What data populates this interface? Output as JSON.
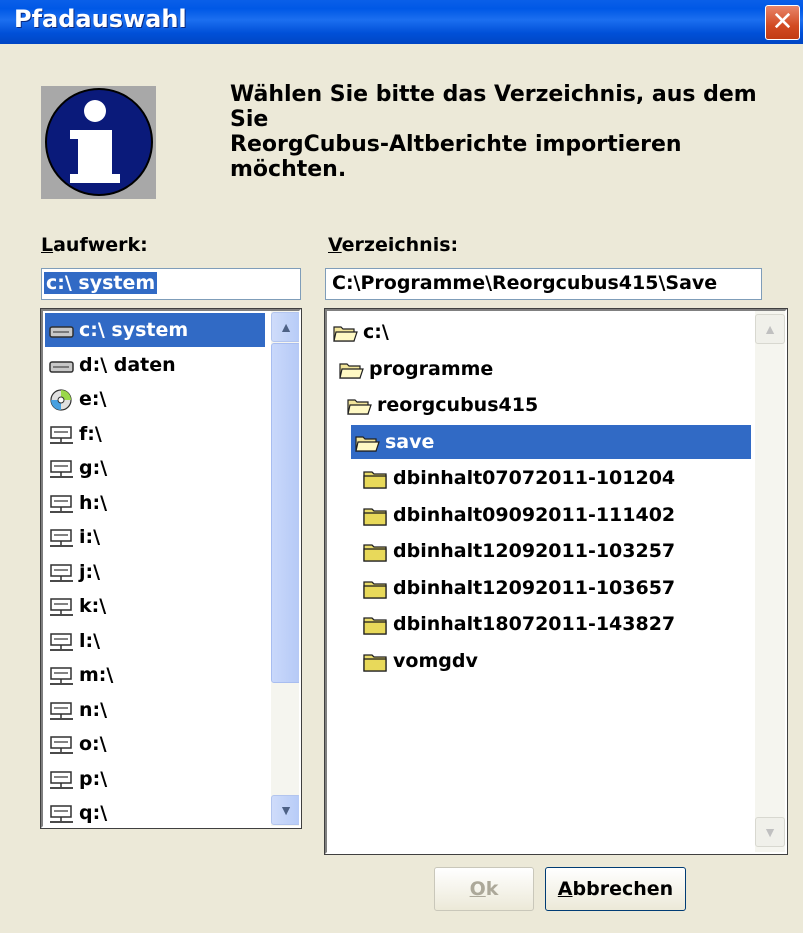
{
  "window": {
    "title": "Pfadauswahl",
    "close_glyph": "✕"
  },
  "message": {
    "line1": "Wählen Sie bitte das Verzeichnis, aus dem Sie",
    "line2": "ReorgCubus-Altberichte importieren möchten."
  },
  "drive": {
    "label_accel": "L",
    "label_rest": "aufwerk:",
    "value": "c:\\ system",
    "items": [
      {
        "label": "c:\\ system",
        "icon": "hard-drive-icon"
      },
      {
        "label": "d:\\ daten",
        "icon": "hard-drive-icon"
      },
      {
        "label": "e:\\",
        "icon": "cd-drive-icon"
      },
      {
        "label": "f:\\",
        "icon": "network-drive-icon"
      },
      {
        "label": "g:\\",
        "icon": "network-drive-icon"
      },
      {
        "label": "h:\\",
        "icon": "network-drive-icon"
      },
      {
        "label": "i:\\",
        "icon": "network-drive-icon"
      },
      {
        "label": "j:\\",
        "icon": "network-drive-icon"
      },
      {
        "label": "k:\\",
        "icon": "network-drive-icon"
      },
      {
        "label": "l:\\",
        "icon": "network-drive-icon"
      },
      {
        "label": "m:\\",
        "icon": "network-drive-icon"
      },
      {
        "label": "n:\\",
        "icon": "network-drive-icon"
      },
      {
        "label": "o:\\",
        "icon": "network-drive-icon"
      },
      {
        "label": "p:\\",
        "icon": "network-drive-icon"
      },
      {
        "label": "q:\\",
        "icon": "network-drive-icon"
      }
    ],
    "selected_index": 0
  },
  "directory": {
    "label_accel": "V",
    "label_rest": "erzeichnis:",
    "value": "C:\\Programme\\Reorgcubus415\\Save",
    "items": [
      {
        "label": "c:\\",
        "icon": "open-folder-icon"
      },
      {
        "label": "programme",
        "icon": "open-folder-icon"
      },
      {
        "label": "reorgcubus415",
        "icon": "open-folder-icon"
      },
      {
        "label": "save",
        "icon": "open-folder-icon"
      },
      {
        "label": "dbinhalt07072011-101204",
        "icon": "folder-icon"
      },
      {
        "label": "dbinhalt09092011-111402",
        "icon": "folder-icon"
      },
      {
        "label": "dbinhalt12092011-103257",
        "icon": "folder-icon"
      },
      {
        "label": "dbinhalt12092011-103657",
        "icon": "folder-icon"
      },
      {
        "label": "dbinhalt18072011-143827",
        "icon": "folder-icon"
      },
      {
        "label": "vomgdv",
        "icon": "folder-icon"
      }
    ],
    "selected_index": 3
  },
  "buttons": {
    "ok_accel": "O",
    "ok_rest": "k",
    "ok_enabled": false,
    "cancel_accel": "A",
    "cancel_rest": "bbrechen"
  },
  "colors": {
    "title_bar": "#0058e6",
    "selection": "#316ac5",
    "dialog_bg": "#ece9d8"
  }
}
